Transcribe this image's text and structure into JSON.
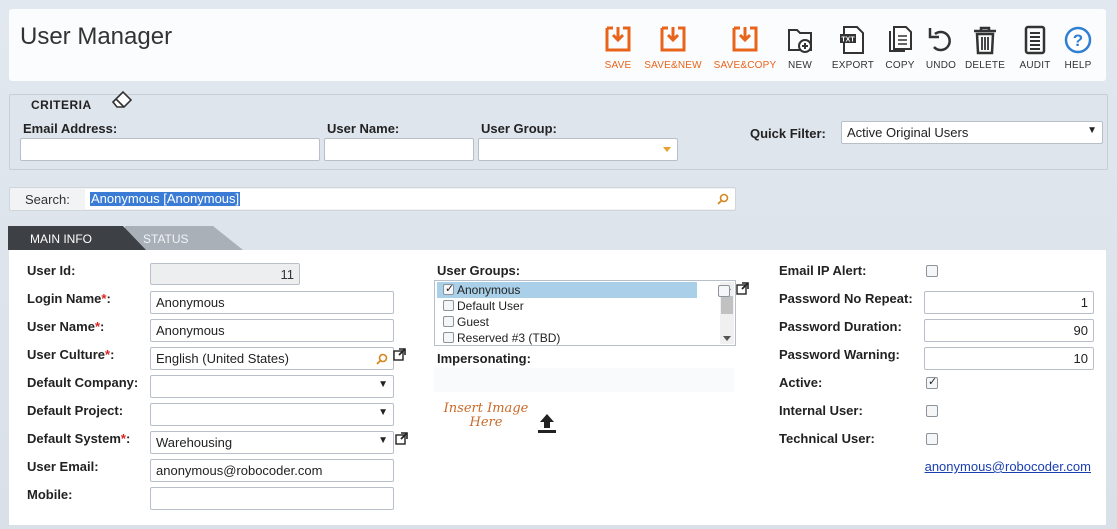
{
  "app": {
    "title": "User Manager"
  },
  "toolbar": {
    "save": "SAVE",
    "save_new": "SAVE&NEW",
    "save_copy": "SAVE&COPY",
    "new": "NEW",
    "export": "EXPORT",
    "copy": "COPY",
    "undo": "UNDO",
    "delete": "DELETE",
    "audit": "AUDIT",
    "help": "HELP",
    "export_badge": "TXT"
  },
  "criteria": {
    "heading": "CRITERIA",
    "email_label": "Email Address:",
    "email_value": "",
    "username_label": "User Name:",
    "username_value": "",
    "usergroup_label": "User Group:",
    "usergroup_value": "",
    "quick_filter_label": "Quick Filter:",
    "quick_filter_value": "Active Original Users"
  },
  "search": {
    "label": "Search:",
    "value": "Anonymous [Anonymous]"
  },
  "tabs": {
    "main": "MAIN INFO",
    "status": "STATUS"
  },
  "form": {
    "user_id_label": "User Id:",
    "user_id": "11",
    "login_name_label": "Login Name",
    "login_name": "Anonymous",
    "user_name_label": "User Name",
    "user_name": "Anonymous",
    "user_culture_label": "User Culture",
    "user_culture": "English (United States)",
    "default_company_label": "Default Company:",
    "default_company": "",
    "default_project_label": "Default Project:",
    "default_project": "",
    "default_system_label": "Default System",
    "default_system": "Warehousing",
    "user_email_label": "User Email:",
    "user_email": "anonymous@robocoder.com",
    "mobile_label": "Mobile:",
    "mobile": "",
    "required_mark": "*",
    "colon": ":"
  },
  "groups": {
    "label": "User Groups:",
    "items": [
      {
        "label": "Anonymous",
        "checked": true,
        "selected": true
      },
      {
        "label": "Default User",
        "checked": false
      },
      {
        "label": "Guest",
        "checked": false
      },
      {
        "label": "Reserved #3 (TBD)",
        "checked": false
      }
    ],
    "impersonating_label": "Impersonating:",
    "insert_image_line1": "Insert Image",
    "insert_image_line2": "Here"
  },
  "right": {
    "email_ip_alert_label": "Email IP Alert:",
    "email_ip_alert": false,
    "pw_no_repeat_label": "Password No Repeat:",
    "pw_no_repeat": "1",
    "pw_duration_label": "Password Duration:",
    "pw_duration": "90",
    "pw_warning_label": "Password Warning:",
    "pw_warning": "10",
    "active_label": "Active:",
    "active": true,
    "internal_label": "Internal User:",
    "internal": false,
    "technical_label": "Technical User:",
    "technical": false,
    "email_link": "anonymous@robocoder.com"
  },
  "colors": {
    "accent_orange": "#e8641b",
    "tab_dark": "#3d4145",
    "tab_grey": "#a9b0b8",
    "selection": "#3a7bd5",
    "link": "#1a3fb0"
  }
}
